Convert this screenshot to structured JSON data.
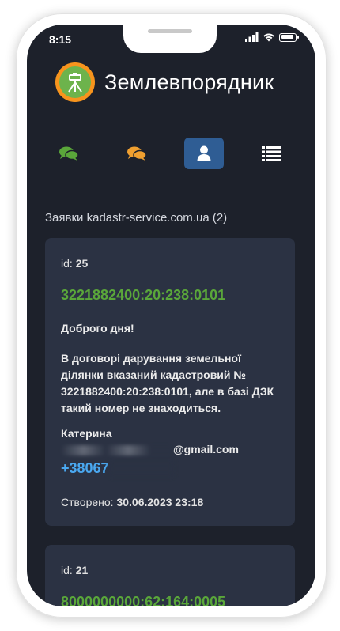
{
  "status_bar": {
    "time": "8:15"
  },
  "app": {
    "title": "Землевпорядник"
  },
  "nav": {
    "items": [
      {
        "icon": "comments-green-icon",
        "color": "#5aa73a",
        "active": false
      },
      {
        "icon": "comments-orange-icon",
        "color": "#f0a030",
        "active": false
      },
      {
        "icon": "user-icon",
        "color": "#ffffff",
        "active": true
      },
      {
        "icon": "list-icon",
        "color": "#ffffff",
        "active": false
      }
    ]
  },
  "section": {
    "title": "Заявки kadastr-service.com.ua (2)"
  },
  "requests": [
    {
      "id_label": "id: ",
      "id": "25",
      "cadastral": "3221882400:20:238:0101",
      "greeting": "Доброго дня!",
      "message": "В договорі дарування земельної ділянки вказаний кадастровий № 3221882400:20:238:0101, але в базі ДЗК такий номер не знаходиться.",
      "name": "Катерина",
      "email_suffix": "@gmail.com",
      "phone": "+38067",
      "created_label": "Створено: ",
      "created": "30.06.2023 23:18"
    },
    {
      "id_label": "id: ",
      "id": "21",
      "cadastral": "8000000000:62:164:0005"
    }
  ],
  "colors": {
    "background": "#1d212b",
    "card": "#2b3243",
    "accent_green": "#5aa73a",
    "link_blue": "#4aa8f0",
    "active_tab": "#2f5d94"
  }
}
